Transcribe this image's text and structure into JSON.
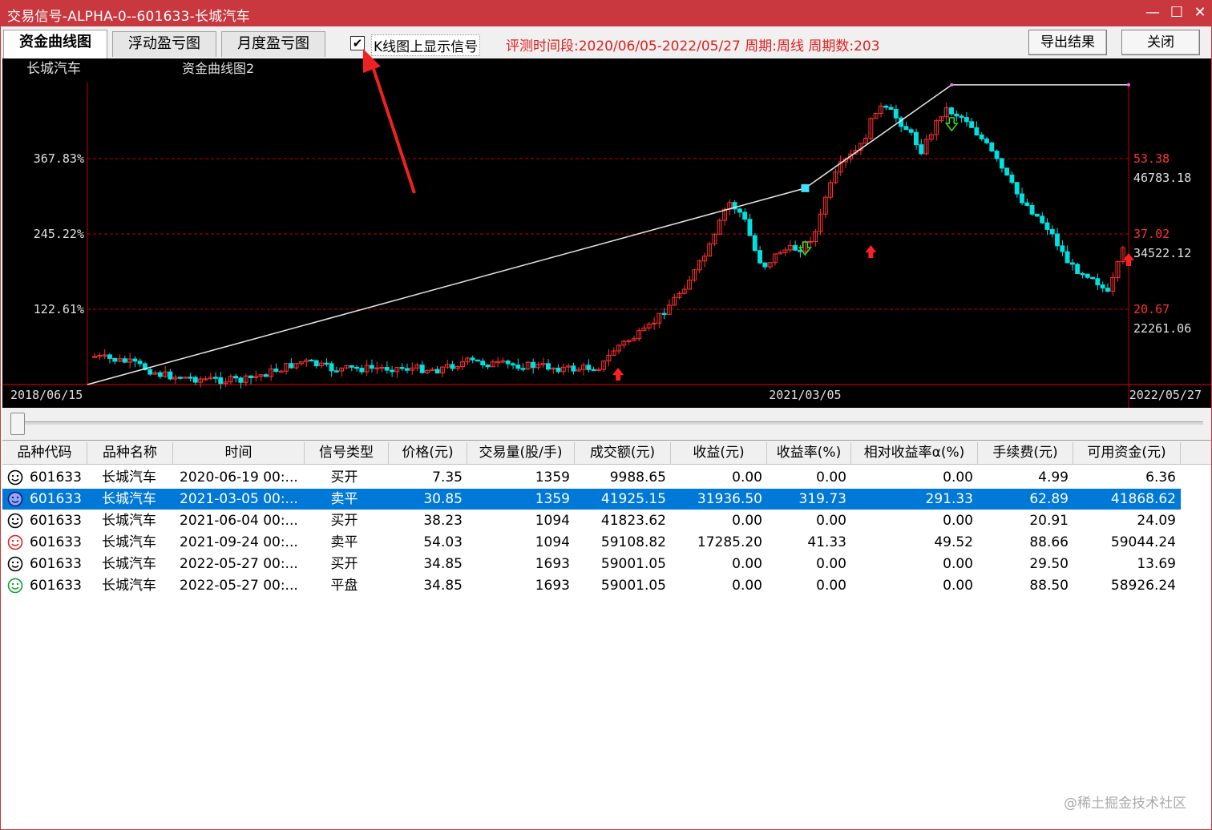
{
  "window": {
    "title": "交易信号-ALPHA-0--601633-长城汽车",
    "minimize": "—",
    "maximize": "☐",
    "close": "✕"
  },
  "toolbar": {
    "tabs": [
      {
        "label": "资金曲线图",
        "active": true
      },
      {
        "label": "浮动盈亏图",
        "active": false
      },
      {
        "label": "月度盈亏图",
        "active": false
      }
    ],
    "checkbox": {
      "label": "K线图上显示信号",
      "checked": true,
      "mark": "✔"
    },
    "eval_info": "评测时间段:2020/06/05-2022/05/27  周期:周线  周期数:203",
    "export_label": "导出结果",
    "close_label": "关闭"
  },
  "chart_data": {
    "type": "line",
    "title": "长城汽车",
    "subtitle": "资金曲线图2",
    "x_ticks": [
      "2018/06/15",
      "2021/03/05",
      "2022/05/27"
    ],
    "left_axis": {
      "ticks": [
        "122.61%",
        "245.22%",
        "367.83%"
      ],
      "values": [
        122.61,
        245.22,
        367.83
      ]
    },
    "right_axis": {
      "price_ticks": [
        "20.67",
        "37.02",
        "53.38"
      ],
      "capital_ticks": [
        "22261.06",
        "34522.12",
        "46783.18"
      ]
    },
    "equity_curve": [
      {
        "date": "2018/06/15",
        "value": 0
      },
      {
        "date": "2021/03/05",
        "value": 319.73
      },
      {
        "date": "2021/09/24",
        "value": 488
      },
      {
        "date": "2022/05/27",
        "value": 488
      }
    ],
    "signals": [
      {
        "date": "2020/06/19",
        "type": "buy"
      },
      {
        "date": "2021/03/05",
        "type": "sell"
      },
      {
        "date": "2021/06/04",
        "type": "buy"
      },
      {
        "date": "2021/09/24",
        "type": "sell"
      },
      {
        "date": "2022/05/27",
        "type": "buy"
      }
    ],
    "colors": {
      "up": "#ff3030",
      "down": "#00e0e0",
      "equity": "#e8e8e8",
      "grid": "#c00000",
      "axis_text": "#e0e0e0",
      "right_price": "#ff3030"
    }
  },
  "table": {
    "headers": [
      "品种代码",
      "品种名称",
      "时间",
      "信号类型",
      "价格(元)",
      "交易量(股/手)",
      "成交额(元)",
      "收益(元)",
      "收益率(%)",
      "相对收益率α(%)",
      "手续费(元)",
      "可用资金(元)"
    ],
    "rows": [
      {
        "code": "601633",
        "name": "长城汽车",
        "time": "2020-06-19 00:...",
        "signal": "买开",
        "price": "7.35",
        "volume": "1359",
        "amount": "9988.65",
        "profit": "0.00",
        "rate": "0.00",
        "alpha": "0.00",
        "fee": "4.99",
        "cash": "6.36",
        "face": "neutral"
      },
      {
        "code": "601633",
        "name": "长城汽车",
        "time": "2021-03-05 00:...",
        "signal": "卖平",
        "price": "30.85",
        "volume": "1359",
        "amount": "41925.15",
        "profit": "31936.50",
        "rate": "319.73",
        "alpha": "291.33",
        "fee": "62.89",
        "cash": "41868.62",
        "face": "neutral-selected"
      },
      {
        "code": "601633",
        "name": "长城汽车",
        "time": "2021-06-04 00:...",
        "signal": "买开",
        "price": "38.23",
        "volume": "1094",
        "amount": "41823.62",
        "profit": "0.00",
        "rate": "0.00",
        "alpha": "0.00",
        "fee": "20.91",
        "cash": "24.09",
        "face": "neutral"
      },
      {
        "code": "601633",
        "name": "长城汽车",
        "time": "2021-09-24 00:...",
        "signal": "卖平",
        "price": "54.03",
        "volume": "1094",
        "amount": "59108.82",
        "profit": "17285.20",
        "rate": "41.33",
        "alpha": "49.52",
        "fee": "88.66",
        "cash": "59044.24",
        "face": "happy"
      },
      {
        "code": "601633",
        "name": "长城汽车",
        "time": "2022-05-27 00:...",
        "signal": "买开",
        "price": "34.85",
        "volume": "1693",
        "amount": "59001.05",
        "profit": "0.00",
        "rate": "0.00",
        "alpha": "0.00",
        "fee": "29.50",
        "cash": "13.69",
        "face": "neutral"
      },
      {
        "code": "601633",
        "name": "长城汽车",
        "time": "2022-05-27 00:...",
        "signal": "平盘",
        "price": "34.85",
        "volume": "1693",
        "amount": "59001.05",
        "profit": "0.00",
        "rate": "0.00",
        "alpha": "0.00",
        "fee": "88.50",
        "cash": "58926.24",
        "face": "green"
      }
    ],
    "watermark": "@稀土掘金技术社区"
  }
}
